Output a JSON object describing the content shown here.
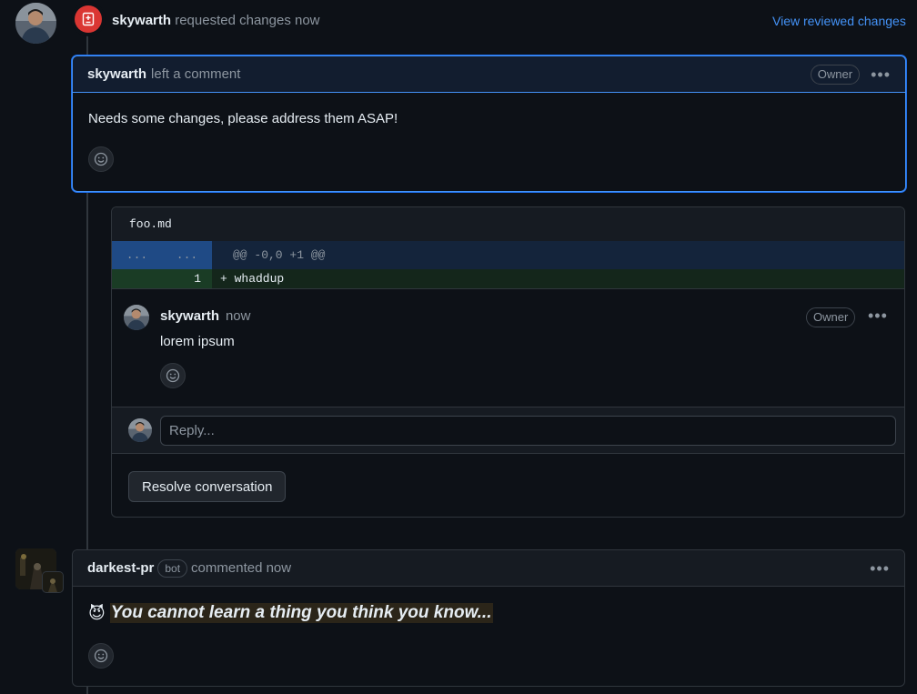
{
  "review": {
    "author": "skywarth",
    "action": "requested changes now",
    "link": "View reviewed changes"
  },
  "main_comment": {
    "author": "skywarth",
    "action": "left a comment",
    "badge": "Owner",
    "body": "Needs some changes, please address them ASAP!"
  },
  "file": {
    "name": "foo.md",
    "hunk_left": "...",
    "hunk_right": "...",
    "hunk_header": "@@ -0,0 +1 @@",
    "line_number": "1",
    "line_content": "+ whaddup"
  },
  "thread_comment": {
    "author": "skywarth",
    "time": "now",
    "badge": "Owner",
    "body": "lorem ipsum"
  },
  "reply": {
    "placeholder": "Reply..."
  },
  "resolve_label": "Resolve conversation",
  "bot_comment": {
    "author": "darkest-pr",
    "bot_badge": "bot",
    "action": "commented now",
    "body": "You cannot learn a thing you think you know...",
    "emoji": "😈"
  },
  "colors": {
    "background": "#0d1117",
    "accent": "#4493f8",
    "danger": "#da3633",
    "diff_added": "#1a3c25",
    "hunk": "#1f3558"
  }
}
